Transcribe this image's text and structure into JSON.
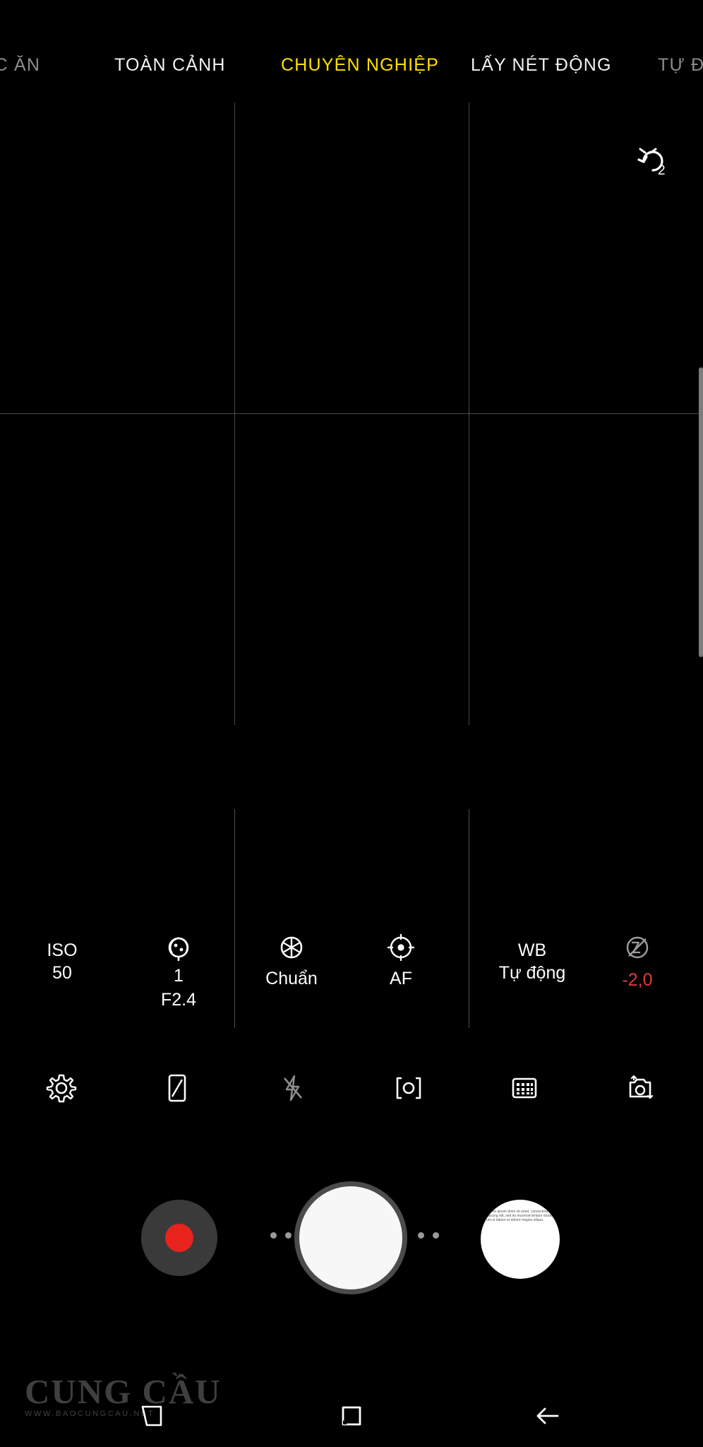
{
  "modes": [
    {
      "label": "ỨC ĂN",
      "state": "clipped"
    },
    {
      "label": "TOÀN CẢNH",
      "state": "normal"
    },
    {
      "label": "CHUYÊN NGHIỆP",
      "state": "active"
    },
    {
      "label": "LẤY NÉT ĐỘNG",
      "state": "normal"
    },
    {
      "label": "TỰ Đ",
      "state": "dim"
    }
  ],
  "viewfinder": {
    "timer_value": "2",
    "timer_icon": "timer-icon",
    "grid": "3x3"
  },
  "pro_controls": [
    {
      "name": "iso",
      "label": "ISO",
      "value": "50",
      "icon": null
    },
    {
      "name": "shutter-speed",
      "label": "",
      "value": "1",
      "value2": "F2.4",
      "icon": "aperture-icon"
    },
    {
      "name": "picture-style",
      "label": "Chuẩn",
      "value": "",
      "icon": "asterisk-icon"
    },
    {
      "name": "focus-mode",
      "label": "AF",
      "value": "",
      "icon": "focus-icon"
    },
    {
      "name": "white-balance",
      "label": "WB",
      "value": "Tự động",
      "icon": null
    },
    {
      "name": "exposure-value",
      "label": "",
      "value": "-2,0",
      "icon": "exposure-icon"
    }
  ],
  "toolbar": [
    {
      "name": "settings",
      "icon": "gear-icon"
    },
    {
      "name": "aspect-ratio",
      "icon": "ratio-icon"
    },
    {
      "name": "flash",
      "icon": "flash-off-icon"
    },
    {
      "name": "metering",
      "icon": "metering-icon"
    },
    {
      "name": "filters",
      "icon": "filters-icon"
    },
    {
      "name": "switch-camera",
      "icon": "camera-switch-icon"
    }
  ],
  "shutter_row": {
    "record_button": "record-button",
    "shutter_button": "shutter-button",
    "gallery_thumbnail": "gallery-thumbnail",
    "thumbnail_text": "Lorem ipsum dolor sit amet, consectetur adipiscing elit, sed do eiusmod tempor incididunt ut labore et dolore magna aliqua."
  },
  "watermark": {
    "title": "CUNG CẦU",
    "url": "WWW.BAOCUNGCAU.NET"
  },
  "navbar": [
    {
      "name": "recents",
      "icon": "recents-icon"
    },
    {
      "name": "home",
      "icon": "home-icon"
    },
    {
      "name": "back",
      "icon": "back-arrow-icon"
    }
  ],
  "colors": {
    "accent": "#ffe000",
    "record": "#e8231e",
    "negative_ev": "#e13b3b",
    "background": "#000000"
  }
}
